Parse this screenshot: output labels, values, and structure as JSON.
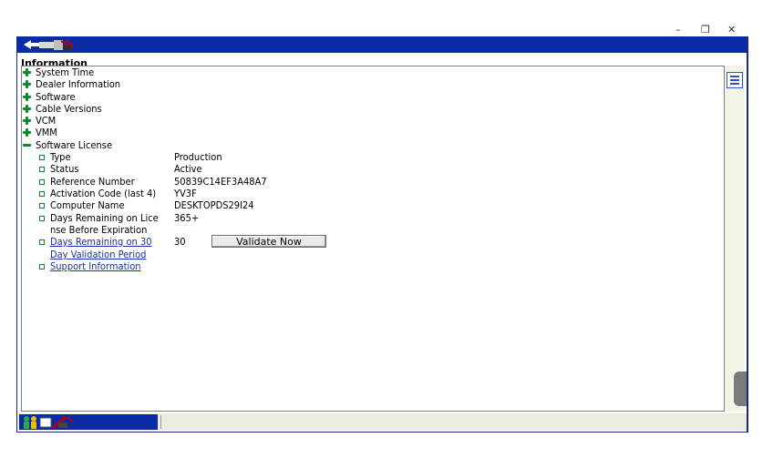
{
  "window_controls": {
    "minimize": "–",
    "restore": "❐",
    "close": "✕"
  },
  "panel": {
    "header": "Information"
  },
  "tree": {
    "sections": [
      {
        "label": "System Time",
        "expanded": false
      },
      {
        "label": "Dealer Information",
        "expanded": false
      },
      {
        "label": "Software",
        "expanded": false
      },
      {
        "label": "Cable Versions",
        "expanded": false
      },
      {
        "label": "VCM",
        "expanded": false
      },
      {
        "label": "VMM",
        "expanded": false
      },
      {
        "label": "Software License",
        "expanded": true
      }
    ],
    "license": {
      "type": {
        "key": "Type",
        "value": "Production"
      },
      "status": {
        "key": "Status",
        "value": "Active"
      },
      "reference": {
        "key": "Reference Number",
        "value": "50839C14EF3A48A7"
      },
      "activation": {
        "key": "Activation Code (last 4)",
        "value": "YV3F"
      },
      "computer": {
        "key": "Computer Name",
        "value": "DESKTOPDS29I24"
      },
      "days_license": {
        "key_line1": "Days Remaining on Lice",
        "key_line2": "nse Before Expiration",
        "value": "365+"
      },
      "days_validation": {
        "key_line1": "Days Remaining on 30",
        "key_line2": "Day Validation Period",
        "value": "30"
      },
      "validate_label": "Validate Now",
      "support": "Support Information"
    }
  },
  "colors": {
    "titlebar": "#0a2aa6",
    "expander": "#0f8a2a",
    "link": "#1a2ea8",
    "statusbar": "#ececdf"
  },
  "icons": {
    "app_logo": "gm-logo-icon",
    "list_view": "list-view-icon",
    "status": "status-tools-icon"
  }
}
